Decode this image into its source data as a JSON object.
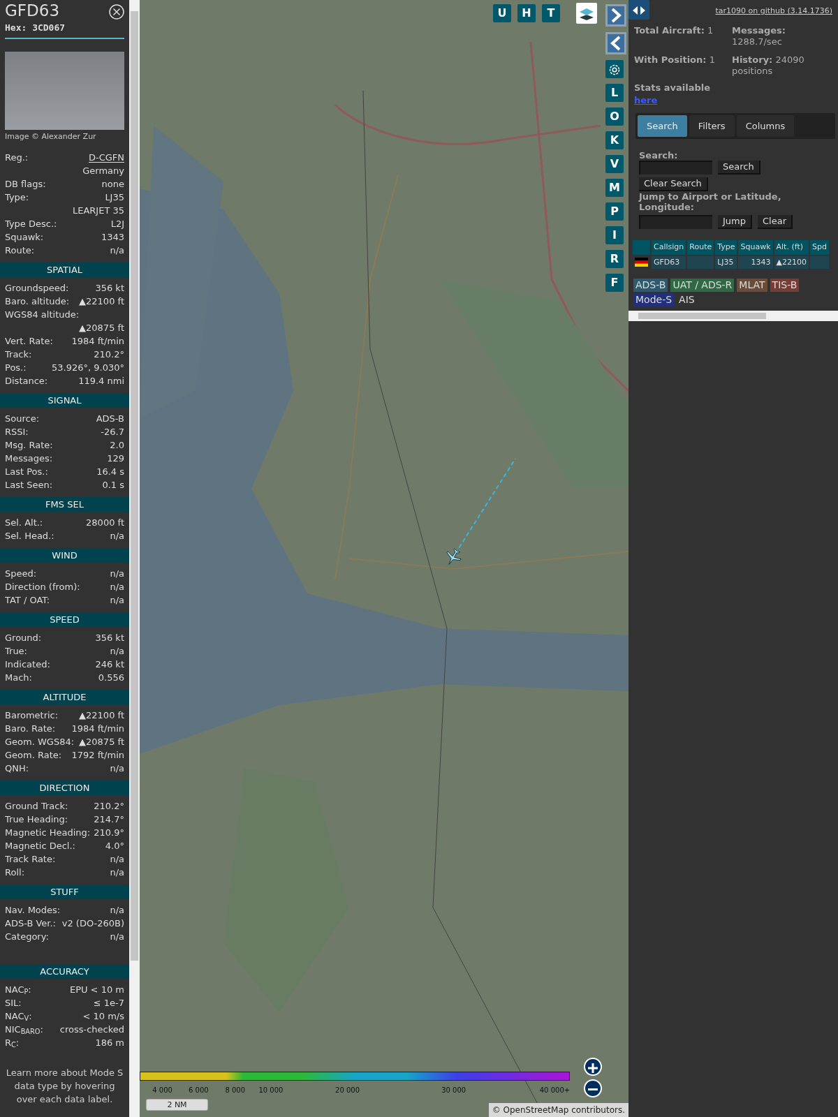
{
  "aircraft_panel": {
    "callsign": "GFD63",
    "hex": "Hex: 3CD067",
    "photo_credit": "Image © Alexander Zur",
    "info_rows": [
      {
        "label": "Reg.:",
        "value": "D-CGFN",
        "kind": "link"
      },
      {
        "value": "Germany"
      },
      {
        "label": "DB flags:",
        "value": "none"
      },
      {
        "label": "Type:",
        "value": "LJ35"
      },
      {
        "value": "LEARJET 35"
      },
      {
        "label": "Type Desc.:",
        "value": "L2J"
      },
      {
        "label": "Squawk:",
        "value": "1343"
      },
      {
        "label": "Route:",
        "value": "n/a"
      }
    ],
    "sections": [
      {
        "title": "SPATIAL",
        "rows": [
          {
            "label": "Groundspeed:",
            "value": "356 kt"
          },
          {
            "label": "Baro. altitude:",
            "value": "▲22100 ft"
          },
          {
            "label": "WGS84 altitude:"
          },
          {
            "value": "▲20875 ft"
          },
          {
            "label": "Vert. Rate:",
            "value": "1984 ft/min"
          },
          {
            "label": "Track:",
            "value": "210.2°"
          },
          {
            "label": "Pos.:",
            "value": "53.926°, 9.030°"
          },
          {
            "label": "Distance:",
            "value": "119.4 nmi"
          }
        ]
      },
      {
        "title": "SIGNAL",
        "rows": [
          {
            "label": "Source:",
            "value": "ADS-B"
          },
          {
            "label": "RSSI:",
            "value": "-26.7"
          },
          {
            "label": "Msg. Rate:",
            "value": "2.0"
          },
          {
            "label": "Messages:",
            "value": "129"
          },
          {
            "label": "Last Pos.:",
            "value": "16.4 s"
          },
          {
            "label": "Last Seen:",
            "value": "0.1 s"
          }
        ]
      },
      {
        "title": "FMS SEL",
        "rows": [
          {
            "label": "Sel. Alt.:",
            "value": "28000 ft"
          },
          {
            "label": "Sel. Head.:",
            "value": "n/a"
          }
        ]
      },
      {
        "title": "WIND",
        "rows": [
          {
            "label": "Speed:",
            "value": "n/a"
          },
          {
            "label": "Direction (from):",
            "value": "n/a"
          },
          {
            "label": "TAT / OAT:",
            "value": "n/a"
          }
        ]
      },
      {
        "title": "SPEED",
        "rows": [
          {
            "label": "Ground:",
            "value": "356 kt"
          },
          {
            "label": "True:",
            "value": "n/a"
          },
          {
            "label": "Indicated:",
            "value": "246 kt"
          },
          {
            "label": "Mach:",
            "value": "0.556"
          }
        ]
      },
      {
        "title": "ALTITUDE",
        "rows": [
          {
            "label": "Barometric:",
            "value": "▲22100 ft"
          },
          {
            "label": "Baro. Rate:",
            "value": "1984 ft/min"
          },
          {
            "label": "Geom. WGS84:",
            "value": "▲20875 ft"
          },
          {
            "label": "Geom. Rate:",
            "value": "1792 ft/min"
          },
          {
            "label": "QNH:",
            "value": "n/a"
          }
        ]
      },
      {
        "title": "DIRECTION",
        "rows": [
          {
            "label": "Ground Track:",
            "value": "210.2°"
          },
          {
            "label": "True Heading:",
            "value": "214.7°"
          },
          {
            "label": "Magnetic Heading:",
            "value": "210.9°"
          },
          {
            "label": "Magnetic Decl.:",
            "value": "4.0°"
          },
          {
            "label": "Track Rate:",
            "value": "n/a"
          },
          {
            "label": "Roll:",
            "value": "n/a"
          }
        ]
      },
      {
        "title": "STUFF",
        "rows": [
          {
            "label": "Nav. Modes:",
            "value": "n/a"
          },
          {
            "label": "ADS-B Ver.:",
            "value": "v2 (DO-260B)"
          },
          {
            "label": "Category:",
            "value": "n/a"
          }
        ]
      },
      {
        "title": "ACCURACY",
        "rows": [
          {
            "label": "NAC$_{P}$:",
            "value": "EPU < 10 m"
          },
          {
            "label": "SIL:",
            "value": "≤ 1e-7"
          },
          {
            "label": "NAC$_{V}$:",
            "value": "< 10 m/s"
          },
          {
            "label": "NIC$_{BARO}$:",
            "value": "cross-checked"
          },
          {
            "label": "R$_{C}$:",
            "value": "186 m"
          }
        ]
      }
    ],
    "footer_note": "Learn more about Mode S data type by hovering over each data label."
  },
  "map": {
    "top_buttons": [
      "U",
      "H",
      "T"
    ],
    "side_buttons": [
      "L",
      "O",
      "K",
      "V",
      "M",
      "P",
      "I",
      "R",
      "F"
    ],
    "altitude_legend": [
      "4 000",
      "6 000",
      "8 000",
      "10 000",
      "20 000",
      "30 000",
      "40 000+"
    ],
    "scale": "2 NM",
    "attribution": "© OpenStreetMap contributors."
  },
  "right_panel": {
    "github_link": "tar1090 on github (3.14.1736)",
    "stats": [
      {
        "label": "Total Aircraft:",
        "value": "1"
      },
      {
        "label": "Messages:",
        "value": "1288.7/sec"
      },
      {
        "label": "With Position:",
        "value": "1"
      },
      {
        "label": "History:",
        "value": "24090 positions"
      }
    ],
    "stats_text": "Stats available",
    "stats_link": "here",
    "tabs": [
      {
        "label": "Search",
        "selected": true
      },
      {
        "label": "Filters",
        "selected": false
      },
      {
        "label": "Columns",
        "selected": false
      }
    ],
    "search_label": "Search:",
    "search_button": "Search",
    "clear_search_button": "Clear Search",
    "jump_label": "Jump to Airport or Latitude, Longitude:",
    "jump_button": "Jump",
    "clear_button": "Clear",
    "table": {
      "columns": [
        "Callsign",
        "Route",
        "Type",
        "Squawk",
        "Alt. (ft)",
        "Spd"
      ],
      "rows": [
        {
          "callsign": "GFD63",
          "type": "LJ35",
          "squawk": "1343",
          "altitude": "▲22100"
        }
      ]
    },
    "sources": [
      {
        "label": "ADS-B",
        "color": "#2c5a6e"
      },
      {
        "label": "UAT / ADS-R",
        "color": "#2f6a45"
      },
      {
        "label": "MLAT",
        "color": "#6a4c38"
      },
      {
        "label": "TIS-B",
        "color": "#773c33"
      },
      {
        "label": "Mode-S",
        "color": "#22307a"
      },
      {
        "label": "AIS"
      }
    ]
  }
}
